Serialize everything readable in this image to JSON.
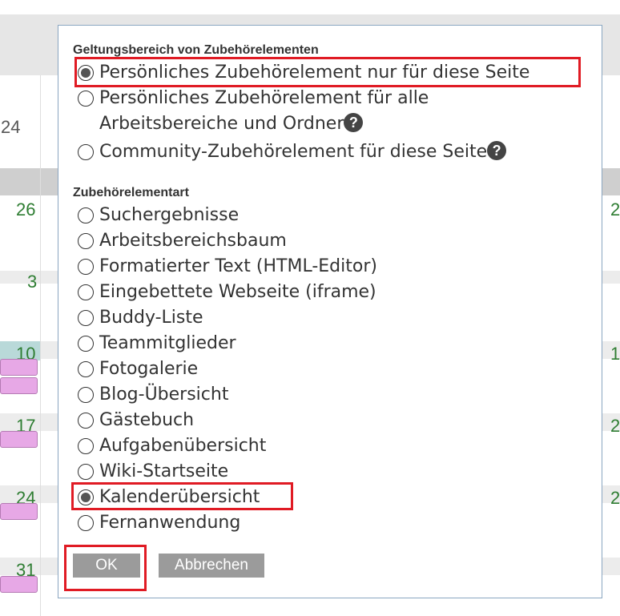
{
  "calendar": {
    "partial_days": [
      "24",
      "26",
      "3",
      "10",
      "17",
      "24",
      "31"
    ],
    "right_partial_days": [
      "2",
      "1",
      "2",
      "2"
    ]
  },
  "dialog": {
    "scope": {
      "title": "Geltungsbereich von Zubehörelementen",
      "options": [
        {
          "label": "Persönliches Zubehörelement nur für diese Seite",
          "checked": true
        },
        {
          "label": "Persönliches Zubehörelement für alle",
          "label_line2": "Arbeitsbereiche und Ordner",
          "checked": false,
          "help_icon": "help-icon"
        },
        {
          "label": "Community-Zubehörelement für diese Seite",
          "checked": false,
          "help_icon": "help-icon"
        }
      ]
    },
    "type": {
      "title": "Zubehörelementart",
      "options": [
        {
          "label": "Suchergebnisse",
          "checked": false
        },
        {
          "label": "Arbeitsbereichsbaum",
          "checked": false
        },
        {
          "label": "Formatierter Text (HTML-Editor)",
          "checked": false
        },
        {
          "label": "Eingebettete Webseite (iframe)",
          "checked": false
        },
        {
          "label": "Buddy-Liste",
          "checked": false
        },
        {
          "label": "Teammitglieder",
          "checked": false
        },
        {
          "label": "Fotogalerie",
          "checked": false
        },
        {
          "label": "Blog-Übersicht",
          "checked": false
        },
        {
          "label": "Gästebuch",
          "checked": false
        },
        {
          "label": "Aufgabenübersicht",
          "checked": false
        },
        {
          "label": "Wiki-Startseite",
          "checked": false
        },
        {
          "label": "Kalenderübersicht",
          "checked": true
        },
        {
          "label": "Fernanwendung",
          "checked": false
        }
      ]
    },
    "buttons": {
      "ok": "OK",
      "cancel": "Abbrechen"
    },
    "help_glyph": "?"
  },
  "colors": {
    "highlight": "#e01b24",
    "button": "#9b9b9b",
    "day_number": "#2e7d32",
    "event": "#e7a8e6"
  }
}
